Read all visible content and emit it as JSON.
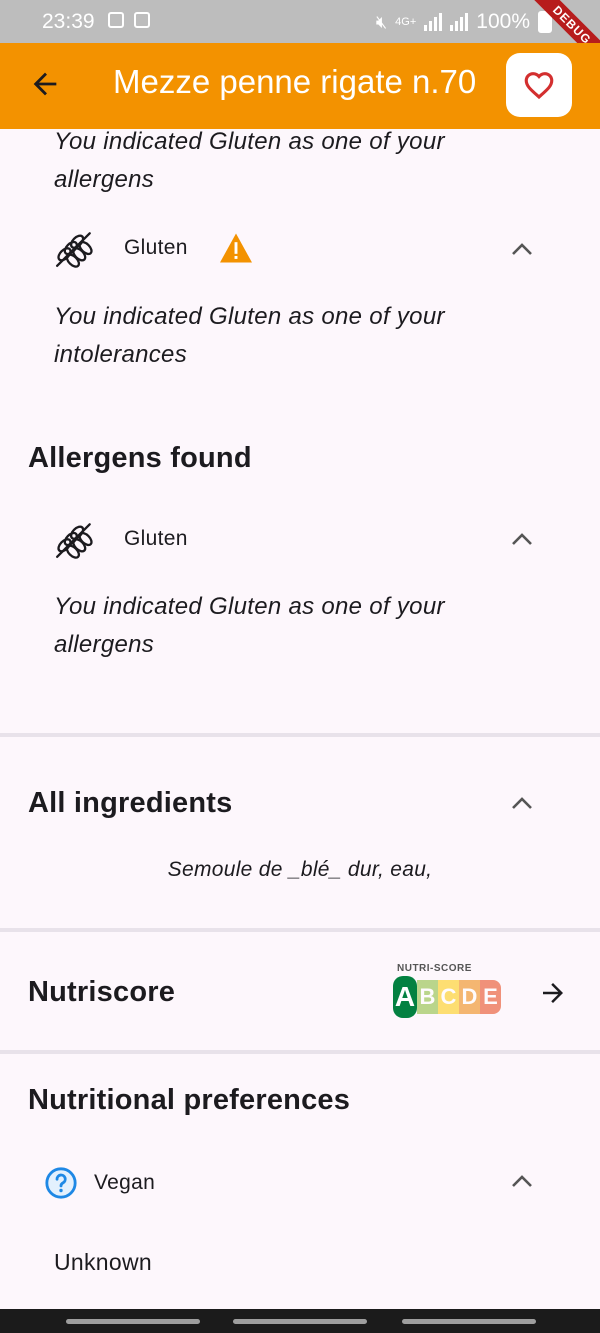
{
  "status_bar": {
    "time": "23:39",
    "network": "4G+",
    "battery": "100%",
    "debug_label": "DEBUG"
  },
  "app_bar": {
    "title": "Mezze penne rigate n.70"
  },
  "sections": {
    "top_allergen_text": "You indicated Gluten as one of your allergens",
    "intolerance_item": {
      "label": "Gluten",
      "text": "You indicated Gluten as one of your intolerances"
    },
    "allergens_found": {
      "title": "Allergens found",
      "item_label": "Gluten",
      "text": "You indicated Gluten as one of your allergens"
    },
    "ingredients": {
      "title": "All ingredients",
      "text": "Semoule de _blé_ dur, eau,"
    },
    "nutriscore": {
      "title": "Nutriscore",
      "badge_label": "NUTRI-SCORE",
      "grades": [
        "A",
        "B",
        "C",
        "D",
        "E"
      ],
      "selected": "A"
    },
    "nutritional_preferences": {
      "title": "Nutritional preferences",
      "item_label": "Vegan",
      "status": "Unknown"
    }
  },
  "colors": {
    "accent": "#f39200",
    "warning": "#f39200",
    "heart": "#d32f2f",
    "help_icon": "#1e88e5"
  }
}
